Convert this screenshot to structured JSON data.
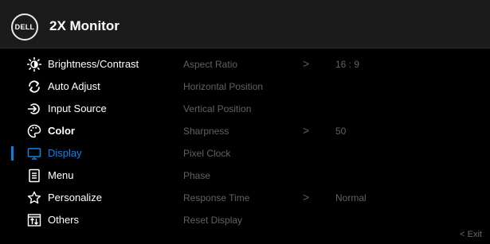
{
  "header": {
    "logo_text": "DELL",
    "title": "2X Monitor"
  },
  "menu": {
    "items": [
      {
        "label": "Brightness/Contrast",
        "icon": "brightness-icon"
      },
      {
        "label": "Auto Adjust",
        "icon": "auto-adjust-icon"
      },
      {
        "label": "Input Source",
        "icon": "input-source-icon"
      },
      {
        "label": "Color",
        "icon": "color-icon"
      },
      {
        "label": "Display",
        "icon": "display-icon"
      },
      {
        "label": "Menu",
        "icon": "menu-icon"
      },
      {
        "label": "Personalize",
        "icon": "star-icon"
      },
      {
        "label": "Others",
        "icon": "others-icon"
      }
    ],
    "selected": "Display",
    "accent_color": "#0a84ea"
  },
  "submenu": {
    "rows": [
      {
        "name": "Aspect Ratio",
        "arrow": ">",
        "value": "16 : 9"
      },
      {
        "name": "Horizontal Position",
        "arrow": "",
        "value": ""
      },
      {
        "name": "Vertical Position",
        "arrow": "",
        "value": ""
      },
      {
        "name": "Sharpness",
        "arrow": ">",
        "value": "50"
      },
      {
        "name": "Pixel Clock",
        "arrow": "",
        "value": ""
      },
      {
        "name": "Phase",
        "arrow": "",
        "value": ""
      },
      {
        "name": "Response Time",
        "arrow": ">",
        "value": "Normal"
      },
      {
        "name": "Reset Display",
        "arrow": "",
        "value": ""
      }
    ]
  },
  "footer": {
    "exit_label": "< Exit"
  }
}
